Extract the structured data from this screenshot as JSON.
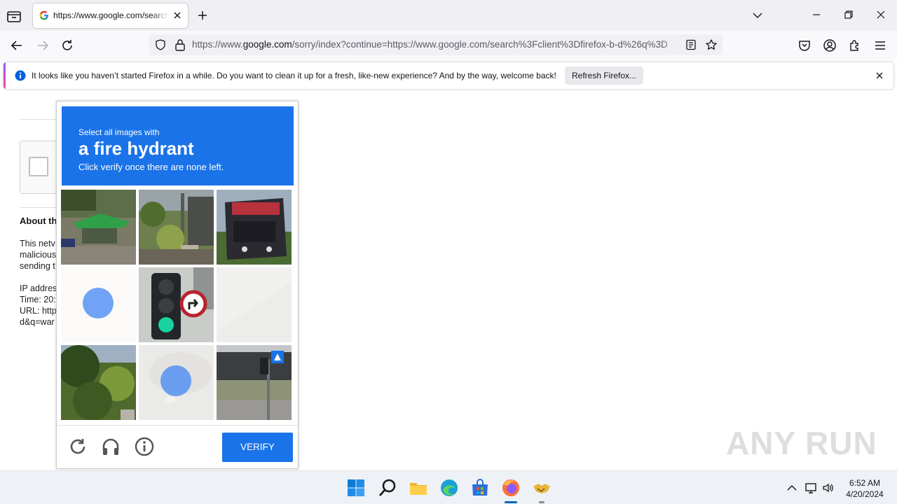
{
  "browser": {
    "tab": {
      "title": "https://www.google.com/search?client=firefox-b-d&q="
    },
    "url": {
      "domain_prefix": "https://www.",
      "domain": "google.com",
      "path": "/sorry/index?continue=https://www.google.com/search%3Fclient%3Dfirefox-b-d%26q%3D"
    },
    "notification": {
      "message": "It looks like you haven’t started Firefox in a while. Do you want to clean it up for a fresh, like-new experience? And by the way, welcome back!",
      "button": "Refresh Firefox..."
    }
  },
  "page": {
    "about_heading": "About th",
    "para": [
      "This netv",
      "malicious",
      "sending t"
    ],
    "info": [
      "IP addres",
      "Time: 20:",
      "URL: http",
      "d&q=war"
    ]
  },
  "captcha": {
    "instruction_small": "Select all images with",
    "instruction_target": "a fire hydrant",
    "instruction_hint": "Click verify once there are none left.",
    "verify_label": "VERIFY",
    "tiles": [
      {
        "subject": "green canopy tent",
        "state": "normal"
      },
      {
        "subject": "street lamp and plants",
        "state": "normal"
      },
      {
        "subject": "red truck front",
        "state": "normal"
      },
      {
        "subject": "blank tile",
        "state": "fading-selected"
      },
      {
        "subject": "traffic light with turn sign",
        "state": "normal"
      },
      {
        "subject": "blank tile",
        "state": "fading"
      },
      {
        "subject": "trees and bushes",
        "state": "normal"
      },
      {
        "subject": "pavement",
        "state": "fading-selected"
      },
      {
        "subject": "crosswalk signal by building",
        "state": "normal"
      }
    ]
  },
  "watermark": "ANY RUN",
  "taskbar": {
    "apps": [
      "windows-start",
      "search",
      "file-explorer",
      "edge",
      "store",
      "firefox",
      "anyrun-handshake"
    ],
    "time": "6:52 AM",
    "date": "4/20/2024"
  },
  "colors": {
    "captcha_blue": "#1a73e8",
    "firefox_accent": "#9059ff"
  }
}
